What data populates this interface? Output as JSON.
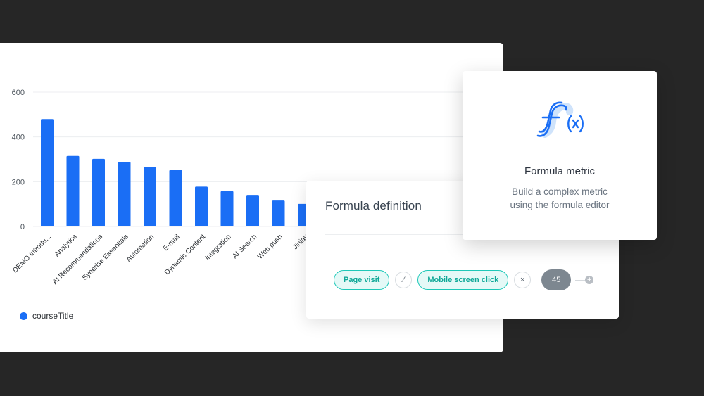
{
  "chart_data": {
    "type": "bar",
    "categories": [
      "DEMO Introdu...",
      "Analytics",
      "AI Recommendations",
      "Synerise Essentials",
      "Automation",
      "E-mail",
      "Dynamic Content",
      "Integration",
      "AI Search",
      "Web push",
      "Jinjav"
    ],
    "values": [
      480,
      315,
      302,
      288,
      266,
      252,
      178,
      158,
      141,
      116,
      101
    ],
    "yticks": [
      0,
      200,
      400,
      600
    ],
    "ylim": [
      0,
      600
    ],
    "legend": "courseTitle",
    "color": "#1a6ef5"
  },
  "formula": {
    "title": "Formula definition",
    "operand1": "Page visit",
    "operator1": "⁄",
    "operand2": "Mobile screen click",
    "operator2": "×",
    "number": "45",
    "add": "+"
  },
  "metric": {
    "icon": "formula-fx-icon",
    "title": "Formula metric",
    "desc_line1": "Build a complex metric",
    "desc_line2": "using the formula editor"
  }
}
